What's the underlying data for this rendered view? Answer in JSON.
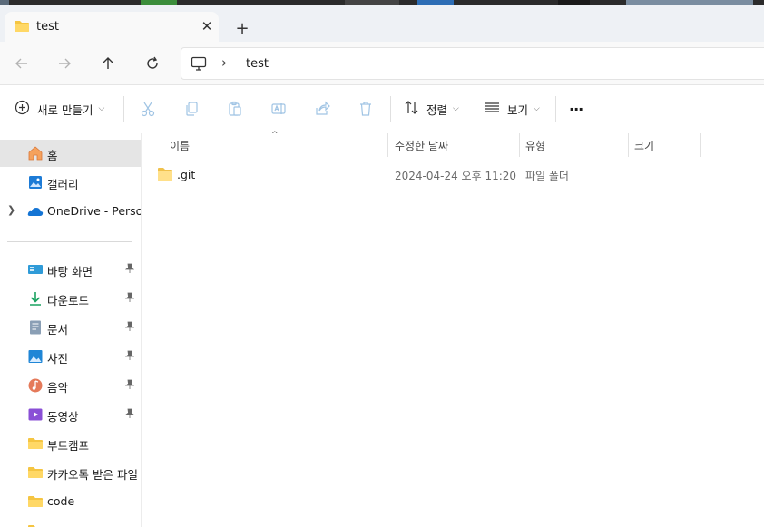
{
  "window": {
    "tab_title": "test",
    "new_tab": "+",
    "close_tab": "✕"
  },
  "address": {
    "separator": "›",
    "breadcrumb": "test"
  },
  "commands": {
    "new_label": "새로 만들기",
    "sort_label": "정렬",
    "view_label": "보기",
    "more_label": "···"
  },
  "sidebar": {
    "items": [
      {
        "label": "홈",
        "icon": "home-icon"
      },
      {
        "label": "갤러리",
        "icon": "gallery-icon"
      },
      {
        "label": "OneDrive - Persona",
        "icon": "onedrive-cloud-icon"
      },
      {
        "label": "바탕 화면",
        "icon": "desktop-icon"
      },
      {
        "label": "다운로드",
        "icon": "download-icon"
      },
      {
        "label": "문서",
        "icon": "document-icon"
      },
      {
        "label": "사진",
        "icon": "pictures-icon"
      },
      {
        "label": "음악",
        "icon": "music-icon"
      },
      {
        "label": "동영상",
        "icon": "video-icon"
      },
      {
        "label": "부트캠프",
        "icon": "folder-icon"
      },
      {
        "label": "카카오톡 받은 파일",
        "icon": "folder-icon"
      },
      {
        "label": "code",
        "icon": "folder-icon"
      }
    ]
  },
  "columns": {
    "name": "이름",
    "modified": "수정한 날짜",
    "type": "유형",
    "size": "크기"
  },
  "files": [
    {
      "name": ".git",
      "modified": "2024-04-24 오후 11:20",
      "type": "파일 폴더",
      "size": ""
    }
  ],
  "colors": {
    "folder": "#f5c542",
    "accent": "#0067c0",
    "selected_bg": "#e5e5e5"
  }
}
